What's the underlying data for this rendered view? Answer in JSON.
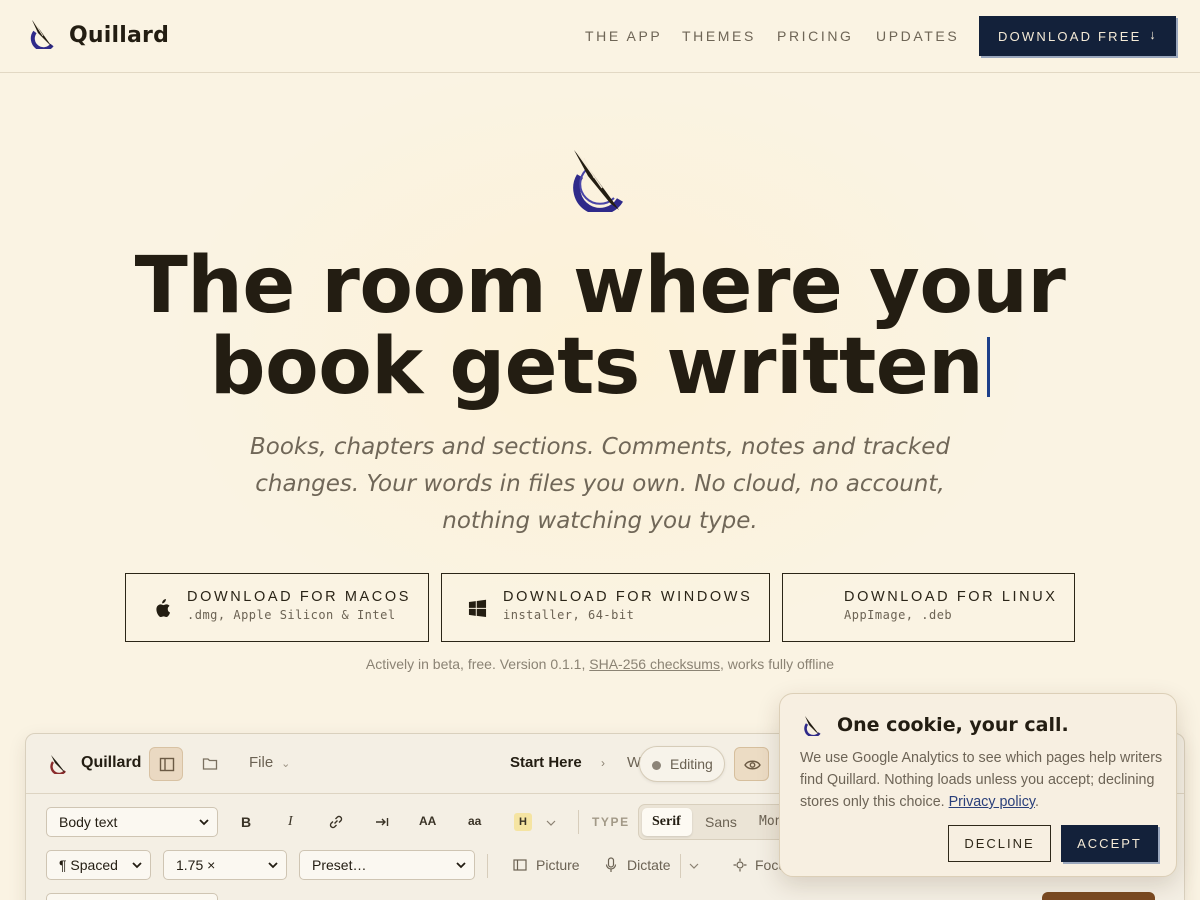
{
  "nav": {
    "brand": "Quillard",
    "links": [
      "THE APP",
      "THEMES",
      "PRICING",
      "UPDATES"
    ],
    "cta_label": "DOWNLOAD FREE",
    "cta_icon": "↓"
  },
  "hero": {
    "title_line1": "The room where your",
    "title_line2": "book gets written",
    "subtitle": "Books, chapters and sections. Comments, notes and tracked changes. Your words in files you own. No cloud, no account, nothing watching you type.",
    "downloads": [
      {
        "title": "DOWNLOAD FOR MACOS",
        "sub": ".dmg, Apple Silicon & Intel",
        "icon": "apple-icon"
      },
      {
        "title": "DOWNLOAD FOR WINDOWS",
        "sub": "installer, 64-bit",
        "icon": "windows-icon"
      },
      {
        "title": "DOWNLOAD FOR LINUX",
        "sub": "AppImage, .deb",
        "icon": "linux-icon"
      }
    ],
    "meta_prefix": "Actively in beta, free. Version 0.1.1,",
    "meta_link": "SHA-256 checksums",
    "meta_suffix": ", works fully offline"
  },
  "app": {
    "brand": "Quillard",
    "file_menu": "File",
    "breadcrumb_current": "Start Here",
    "breadcrumb_sep": "›",
    "breadcrumb_next": "W",
    "mode_label": "Editing",
    "style_select": "Body text",
    "bold": "B",
    "italic": "I",
    "upper": "AA",
    "lower": "aa",
    "highlight": "H",
    "type_label": "TYPE",
    "type_options": [
      "Serif",
      "Sans",
      "Mono"
    ],
    "type_selected": "Serif",
    "spacing_select": "¶ Spaced",
    "line_height_select": "1.75 ×",
    "preset_select": "Preset…",
    "picture_label": "Picture",
    "dictate_label": "Dictate",
    "focus_label": "Focus"
  },
  "cookie": {
    "title": "One cookie, your call.",
    "body": "We use Google Analytics to see which pages help writers find Quillard. Nothing loads unless you accept; declining stores only this choice.",
    "link": "Privacy policy",
    "link_suffix": ".",
    "decline": "DECLINE",
    "accept": "ACCEPT"
  },
  "colors": {
    "background": "#faf3e3",
    "navy": "#13213a",
    "ink": "#231d12",
    "logo_purple": "#2f2a8a",
    "caret": "#1d3f8a"
  }
}
